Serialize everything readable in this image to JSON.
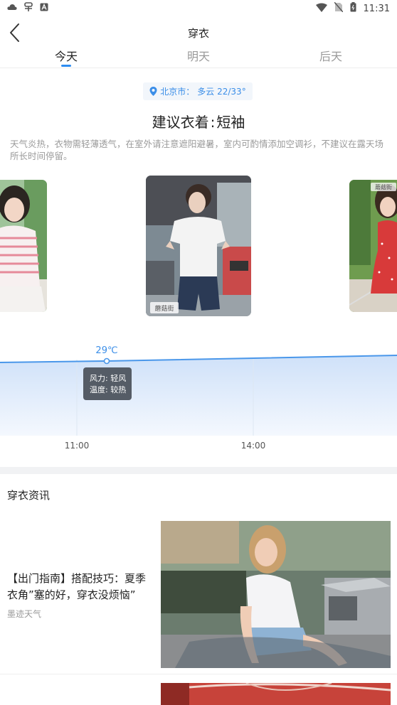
{
  "status_bar": {
    "time": "11:31",
    "left_icons": [
      "cloud-icon",
      "bug-icon",
      "a-box-icon"
    ],
    "right_icons": [
      "wifi-icon",
      "no-sim-icon",
      "battery-icon"
    ]
  },
  "header": {
    "title": "穿衣"
  },
  "tabs": [
    {
      "label": "今天",
      "active": true
    },
    {
      "label": "明天",
      "active": false
    },
    {
      "label": "后天",
      "active": false
    }
  ],
  "location": {
    "city": "北京市：",
    "weather": "多云 22/33°"
  },
  "suggestion": {
    "label": "建议衣着",
    "separator": ":",
    "value": "短袖"
  },
  "description": "天气炎热，衣物需轻薄透气，在室外请注意遮阳避暑，室内可酌情添加空调衫，不建议在露天场所长时间停留。",
  "outfit_photos": [
    {
      "name": "girl-striped-shirt",
      "watermark": ""
    },
    {
      "name": "boy-white-tshirt",
      "watermark": "蘑菇街"
    },
    {
      "name": "girl-red-dress",
      "watermark": "蘑菇街"
    }
  ],
  "chart_data": {
    "type": "area",
    "x": [
      "11:00",
      "14:00"
    ],
    "highlight": {
      "time": "11:00",
      "temp_label": "29℃",
      "tooltip_wind": "风力: 轻风",
      "tooltip_temp": "温度: 较热"
    },
    "colors": {
      "line": "#4a97ea",
      "fill_top": "#cfe1f9",
      "fill_bottom": "#f4f8fe",
      "label": "#3b8ee8"
    }
  },
  "news": {
    "section_title": "穿衣资讯",
    "items": [
      {
        "title": "【出门指南】搭配技巧：夏季衣角”塞的好，穿衣没烦恼”",
        "source": "墨迹天气"
      },
      {
        "title": "",
        "source": ""
      }
    ]
  },
  "colors": {
    "accent": "#2d8cf0"
  }
}
